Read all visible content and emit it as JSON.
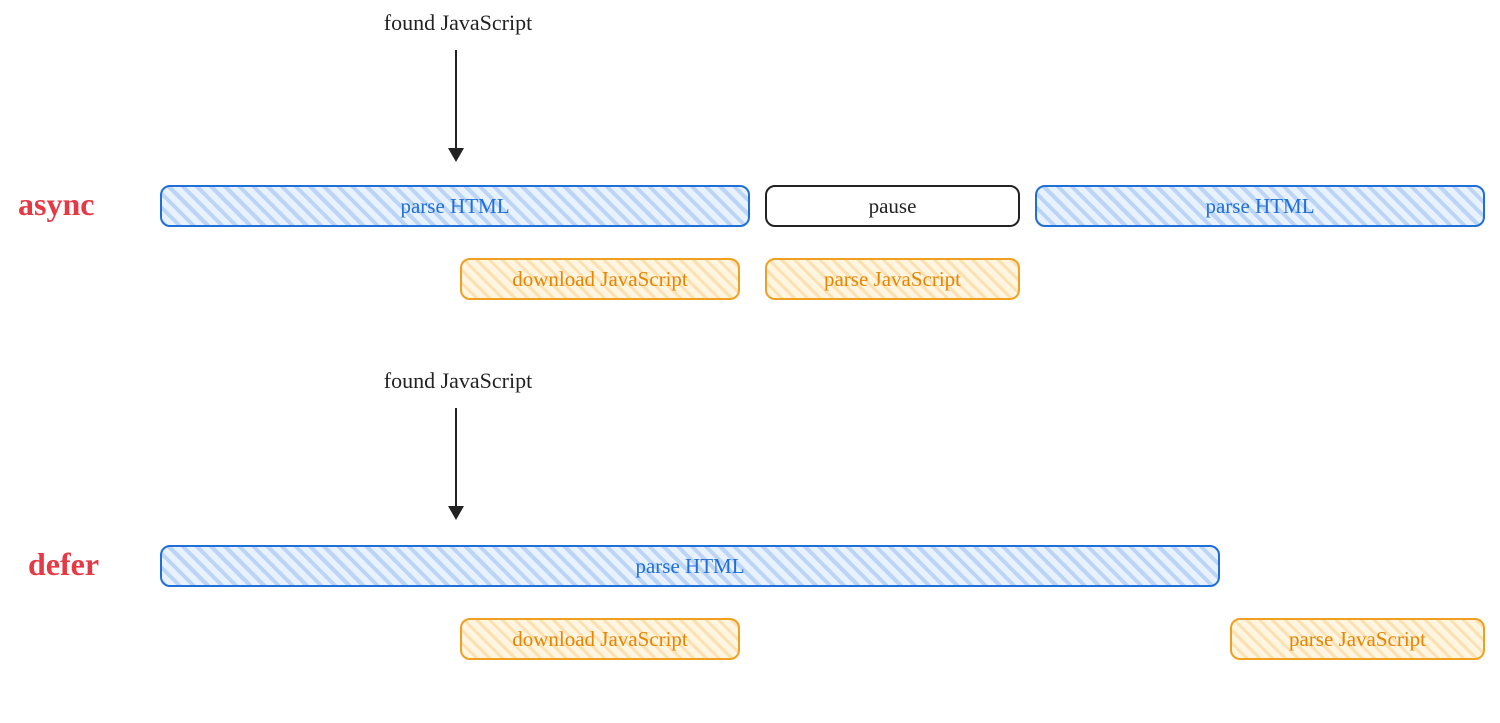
{
  "annotations": {
    "found_js_async": "found JavaScript",
    "found_js_defer": "found JavaScript"
  },
  "sections": {
    "async_label": "async",
    "defer_label": "defer"
  },
  "async_row": {
    "parse_html_1": "parse HTML",
    "pause": "pause",
    "parse_html_2": "parse HTML",
    "download_js": "download JavaScript",
    "parse_js": "parse JavaScript"
  },
  "defer_row": {
    "parse_html": "parse HTML",
    "download_js": "download JavaScript",
    "parse_js": "parse JavaScript"
  },
  "colors": {
    "accent_label": "#e63946",
    "blue_stroke": "#1f6fd6",
    "orange_stroke": "#f0a020",
    "text": "#222222"
  }
}
